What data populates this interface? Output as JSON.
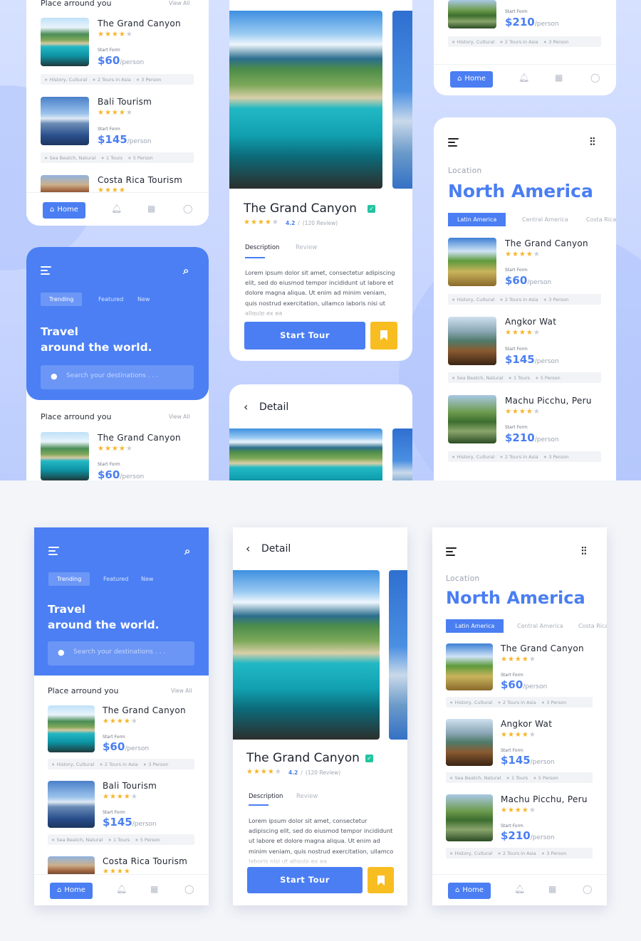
{
  "home": {
    "place_heading": "Place arround you",
    "view_all": "View All",
    "start_form": "Start Form",
    "per": "/person",
    "places": [
      {
        "name": "The Grand Canyon",
        "price": "$60",
        "tags": [
          "History, Cultural",
          "2 Tours in Asia",
          "3 Person"
        ]
      },
      {
        "name": "Bali Tourism",
        "price": "$145",
        "tags": [
          "Sea Beatch, Natural",
          "1 Tours",
          "5 Person"
        ]
      },
      {
        "name": "Costa Rica Tourism"
      }
    ],
    "chips": {
      "trending": "Trending",
      "featured": "Featured",
      "new": "New"
    },
    "hero_line1": "Travel",
    "hero_line2": "around the world.",
    "search_placeholder": "Search your destinations . . ."
  },
  "nav": {
    "home": "Home"
  },
  "detail": {
    "header": "Detail",
    "title": "The Grand Canyon",
    "rating": "4.2",
    "reviews": "(120 Review)",
    "tab_description": "Description",
    "tab_review": "Review",
    "description": "Lorem ipsum dolor sit amet, consectetur adipiscing elit, sed do eiusmod tempor incididunt ut labore et dolore magna aliqua. Ut enim ad minim veniam, quis nostrud exercitation, ullamco laboris nisi ut aliquip ex ea",
    "start_tour": "Start Tour"
  },
  "location": {
    "label": "Location",
    "region": "North America",
    "tabs": [
      "Latin America",
      "Central America",
      "Costa Rica"
    ],
    "places": [
      {
        "name": "The Grand Canyon",
        "price": "$60",
        "tags": [
          "History, Cultural",
          "2 Tours in Asia",
          "3 Person"
        ]
      },
      {
        "name": "Angkor Wat",
        "price": "$145",
        "tags": [
          "Sea Beatch, Natural",
          "1 Tours",
          "5 Person"
        ]
      },
      {
        "name": "Machu Picchu, Peru",
        "price": "$210",
        "tags": [
          "History, Cultural",
          "2 Tours in Asia",
          "3 Person"
        ]
      }
    ]
  },
  "icons": {
    "menu": "hamburger-menu-icon",
    "search": "search-icon",
    "location_pin": "location-pin-icon",
    "home": "home-icon",
    "bell": "bell-icon",
    "calendar": "calendar-icon",
    "user": "user-icon",
    "filter": "filter-sliders-icon",
    "back": "chevron-left-icon",
    "verified": "verified-check-icon",
    "bookmark": "bookmark-icon",
    "star": "star-icon"
  },
  "colors": {
    "primary": "#4a7ef2",
    "star": "#f6b52a",
    "bookmark": "#f8bd21",
    "verified": "#22c4a0"
  }
}
